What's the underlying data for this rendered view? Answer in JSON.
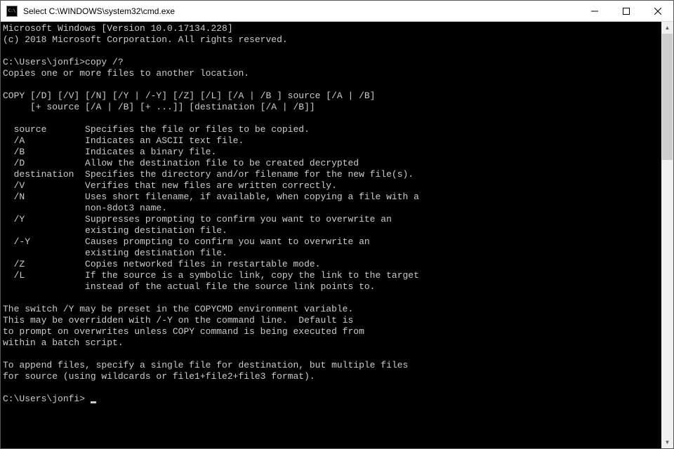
{
  "window": {
    "title": "Select C:\\WINDOWS\\system32\\cmd.exe"
  },
  "terminal": {
    "lines": [
      "Microsoft Windows [Version 10.0.17134.228]",
      "(c) 2018 Microsoft Corporation. All rights reserved.",
      "",
      "C:\\Users\\jonfi>copy /?",
      "Copies one or more files to another location.",
      "",
      "COPY [/D] [/V] [/N] [/Y | /-Y] [/Z] [/L] [/A | /B ] source [/A | /B]",
      "     [+ source [/A | /B] [+ ...]] [destination [/A | /B]]",
      "",
      "  source       Specifies the file or files to be copied.",
      "  /A           Indicates an ASCII text file.",
      "  /B           Indicates a binary file.",
      "  /D           Allow the destination file to be created decrypted",
      "  destination  Specifies the directory and/or filename for the new file(s).",
      "  /V           Verifies that new files are written correctly.",
      "  /N           Uses short filename, if available, when copying a file with a",
      "               non-8dot3 name.",
      "  /Y           Suppresses prompting to confirm you want to overwrite an",
      "               existing destination file.",
      "  /-Y          Causes prompting to confirm you want to overwrite an",
      "               existing destination file.",
      "  /Z           Copies networked files in restartable mode.",
      "  /L           If the source is a symbolic link, copy the link to the target",
      "               instead of the actual file the source link points to.",
      "",
      "The switch /Y may be preset in the COPYCMD environment variable.",
      "This may be overridden with /-Y on the command line.  Default is",
      "to prompt on overwrites unless COPY command is being executed from",
      "within a batch script.",
      "",
      "To append files, specify a single file for destination, but multiple files",
      "for source (using wildcards or file1+file2+file3 format).",
      "",
      "C:\\Users\\jonfi> "
    ]
  }
}
